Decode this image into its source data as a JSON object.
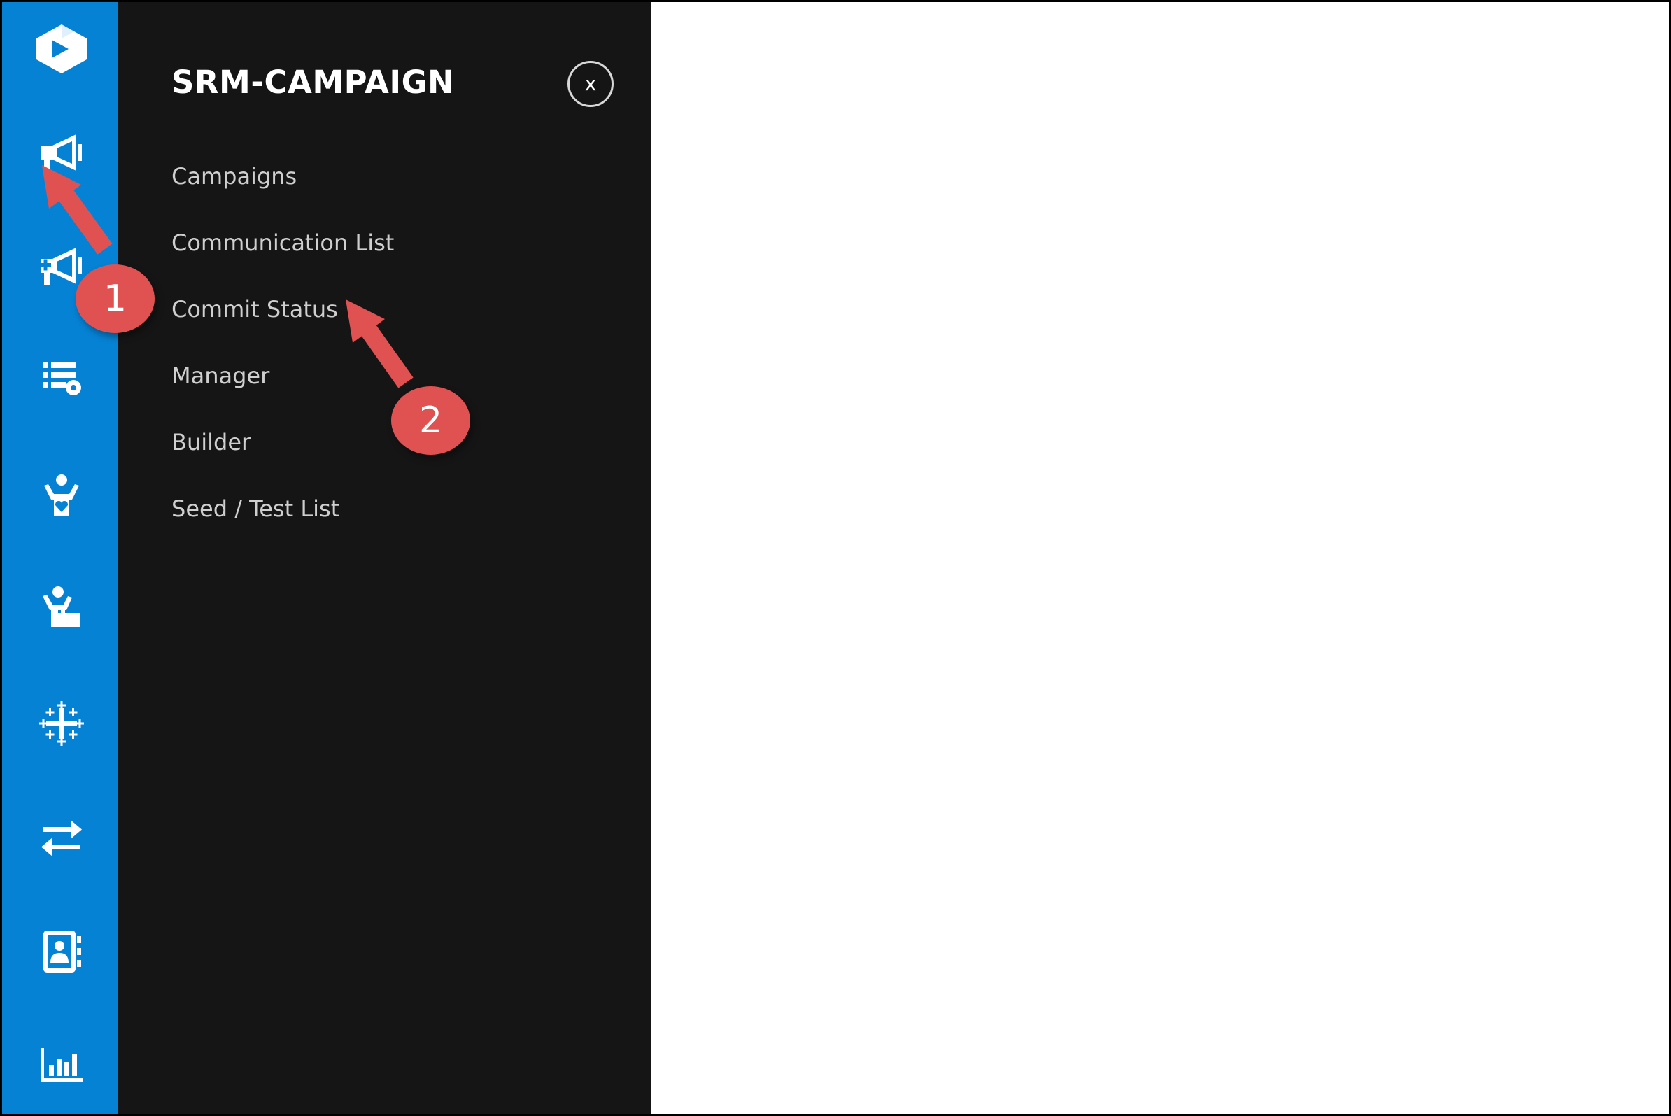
{
  "colors": {
    "rail": "#0682d4",
    "panel": "#151515",
    "menu_text": "#cfcfcf",
    "title_text": "#ffffff",
    "annotation": "#e05252"
  },
  "rail": {
    "icons": [
      "logo-icon",
      "campaign-megaphone-icon",
      "add-campaign-megaphone-icon",
      "list-settings-icon",
      "donor-care-icon",
      "volunteer-icon",
      "tableau-icon",
      "transfer-arrows-icon",
      "contacts-book-icon",
      "bar-chart-icon"
    ]
  },
  "panel": {
    "title": "SRM-CAMPAIGN",
    "close_label": "x",
    "menu": [
      "Campaigns",
      "Communication List",
      "Commit Status",
      "Manager",
      "Builder",
      "Seed / Test List"
    ]
  },
  "annotations": {
    "callout_1": "1",
    "callout_2": "2"
  }
}
